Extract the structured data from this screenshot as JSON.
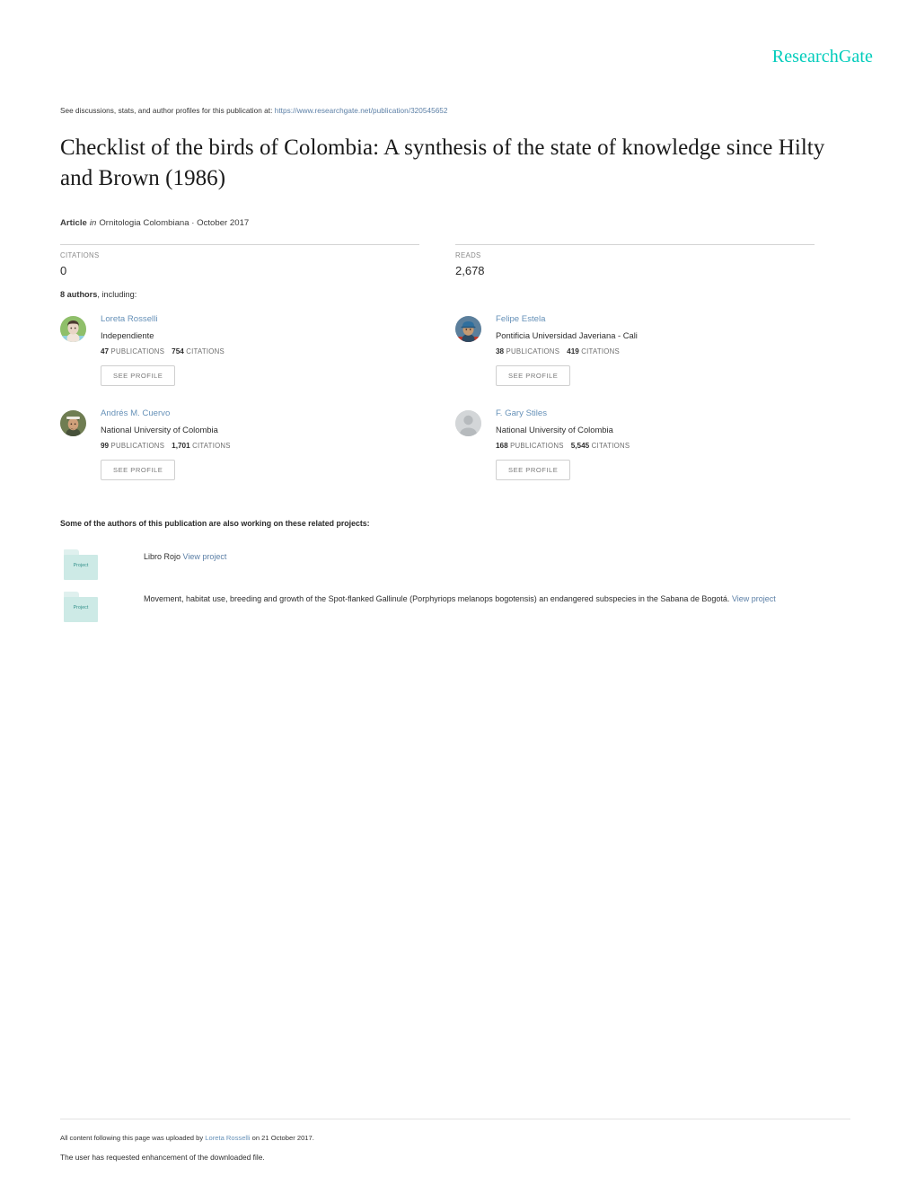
{
  "brand": {
    "logo_text": "ResearchGate",
    "accent_color": "#00ccbb",
    "link_color": "#5b7fa6"
  },
  "header": {
    "discuss_prefix": "See discussions, stats, and author profiles for this publication at:",
    "publication_url": "https://www.researchgate.net/publication/320545652"
  },
  "publication": {
    "title": "Checklist of the birds of Colombia: A synthesis of the state of knowledge since Hilty and Brown (1986)",
    "type_label": "Article",
    "in_word": "in",
    "venue_and_date": "Ornitologia Colombiana · October 2017"
  },
  "stats": {
    "citations_label": "CITATIONS",
    "citations_value": "0",
    "reads_label": "READS",
    "reads_value": "2,678"
  },
  "authors_section": {
    "intro_count": "8 authors",
    "intro_rest": ", including:",
    "see_profile_label": "SEE PROFILE",
    "publications_label": "PUBLICATIONS",
    "citations_label": "CITATIONS",
    "authors": [
      {
        "name": "Loreta Rosselli",
        "affiliation": "Independiente",
        "publications": "47",
        "citations": "754",
        "avatar": "photo-avatar-woman"
      },
      {
        "name": "Felipe Estela",
        "affiliation": "Pontificia Universidad Javeriana - Cali",
        "publications": "38",
        "citations": "419",
        "avatar": "photo-avatar-man-cap"
      },
      {
        "name": "Andrés M. Cuervo",
        "affiliation": "National University of Colombia",
        "publications": "99",
        "citations": "1,701",
        "avatar": "photo-avatar-man-hat"
      },
      {
        "name": "F. Gary Stiles",
        "affiliation": "National University of Colombia",
        "publications": "168",
        "citations": "5,545",
        "avatar": "placeholder-avatar-silhouette"
      }
    ]
  },
  "projects_section": {
    "intro": "Some of the authors of this publication are also working on these related projects:",
    "icon_label": "Project",
    "view_project_label": "View project",
    "projects": [
      {
        "title": "Libro Rojo ",
        "link_text": "View project"
      },
      {
        "title": "Movement, habitat use, breeding and growth of the Spot-flanked Gallinule (Porphyriops melanops bogotensis) an endangered subspecies in the Sabana de Bogotá. ",
        "link_text": "View project"
      }
    ]
  },
  "footer": {
    "upload_prefix": "All content following this page was uploaded by ",
    "uploader": "Loreta Rosselli",
    "upload_suffix": " on 21 October 2017.",
    "enhancement_note": "The user has requested enhancement of the downloaded file."
  }
}
